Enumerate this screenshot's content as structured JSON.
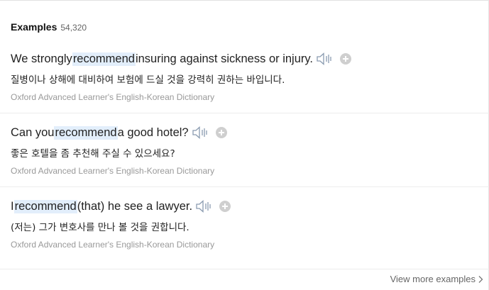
{
  "header": {
    "title": "Examples",
    "count": "54,320"
  },
  "examples": [
    {
      "before": "We strongly ",
      "highlight": "recommend",
      "after": " insuring against sickness or injury.",
      "translation": "질병이나 상해에 대비하여 보험에 드실 것을 강력히 권하는 바입니다.",
      "source": "Oxford Advanced Learner's English-Korean Dictionary"
    },
    {
      "before": "Can you ",
      "highlight": "recommend",
      "after": " a good hotel?",
      "translation": "좋은 호텔을 좀 추천해 주실 수 있으세요?",
      "source": "Oxford Advanced Learner's English-Korean Dictionary"
    },
    {
      "before": "I ",
      "highlight": "recommend",
      "after": " (that) he see a lawyer.",
      "translation": "(저는) 그가 변호사를 만나 볼 것을 권합니다.",
      "source": "Oxford Advanced Learner's English-Korean Dictionary"
    }
  ],
  "footer": {
    "view_more": "View more examples"
  },
  "icons": {
    "speaker": "speaker-icon",
    "add": "plus-circle-icon",
    "chevron": "chevron-right-icon"
  },
  "colors": {
    "highlight": "#e2eefb",
    "muted": "#999999"
  }
}
